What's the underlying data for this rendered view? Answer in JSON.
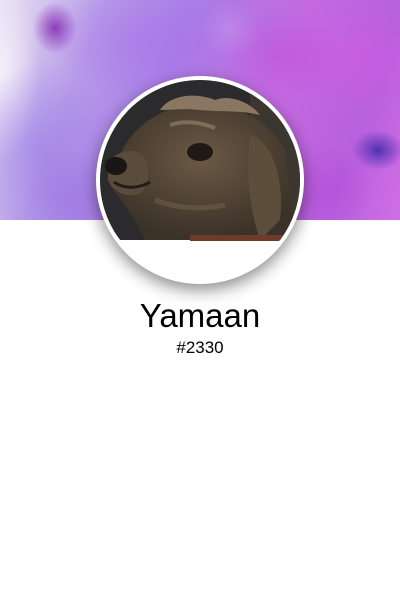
{
  "profile": {
    "name": "Yamaan",
    "handle": "#2330",
    "avatar_icon": "dog-photo",
    "cover_image": "purple-watercolor-banner"
  },
  "colors": {
    "cover_primary": "#b97ae4",
    "avatar_border": "#ffffff",
    "background": "#ffffff",
    "text": "#000000"
  }
}
